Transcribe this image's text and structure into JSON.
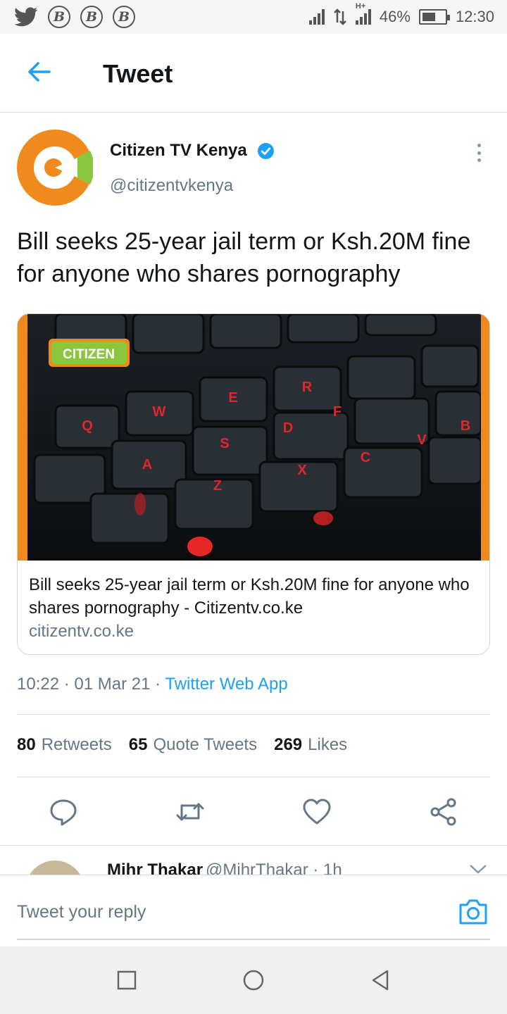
{
  "status_bar": {
    "battery": "46%",
    "time": "12:30",
    "network_h": "H+",
    "notif_badge": "B"
  },
  "header": {
    "title": "Tweet"
  },
  "author": {
    "name": "Citizen TV Kenya",
    "handle": "@citizentvkenya"
  },
  "tweet": {
    "text": "Bill seeks 25-year jail term or Ksh.20M fine for anyone who shares pornography"
  },
  "card": {
    "image_logo": "CITIZEN",
    "keys": [
      "Q",
      "W",
      "E",
      "R",
      "F",
      "A",
      "S",
      "D",
      "C",
      "V",
      "B",
      "Z",
      "X"
    ],
    "title": "Bill seeks 25-year jail term or Ksh.20M fine for anyone who shares pornography - Citizentv.co.ke",
    "domain": "citizentv.co.ke"
  },
  "meta": {
    "time": "10:22",
    "date": "01 Mar 21",
    "separator": "·",
    "app": "Twitter Web App"
  },
  "stats": {
    "retweets_count": "80",
    "retweets_label": "Retweets",
    "quotes_count": "65",
    "quotes_label": "Quote Tweets",
    "likes_count": "269",
    "likes_label": "Likes"
  },
  "reply_preview": {
    "name": "Mihr Thakar",
    "handle": "@MihrThakar · 1h"
  },
  "reply_bar": {
    "placeholder": "Tweet your reply"
  },
  "colors": {
    "twitter_blue": "#1da1f2",
    "text_secondary": "#657786",
    "citizen_orange": "#f08a1c",
    "citizen_green": "#8cc63f"
  },
  "icons": {
    "back": "arrow-left-icon",
    "verified": "verified-badge-icon",
    "more": "more-vertical-icon",
    "reply": "reply-icon",
    "retweet": "retweet-icon",
    "like": "heart-icon",
    "share": "share-icon",
    "camera": "camera-icon"
  }
}
